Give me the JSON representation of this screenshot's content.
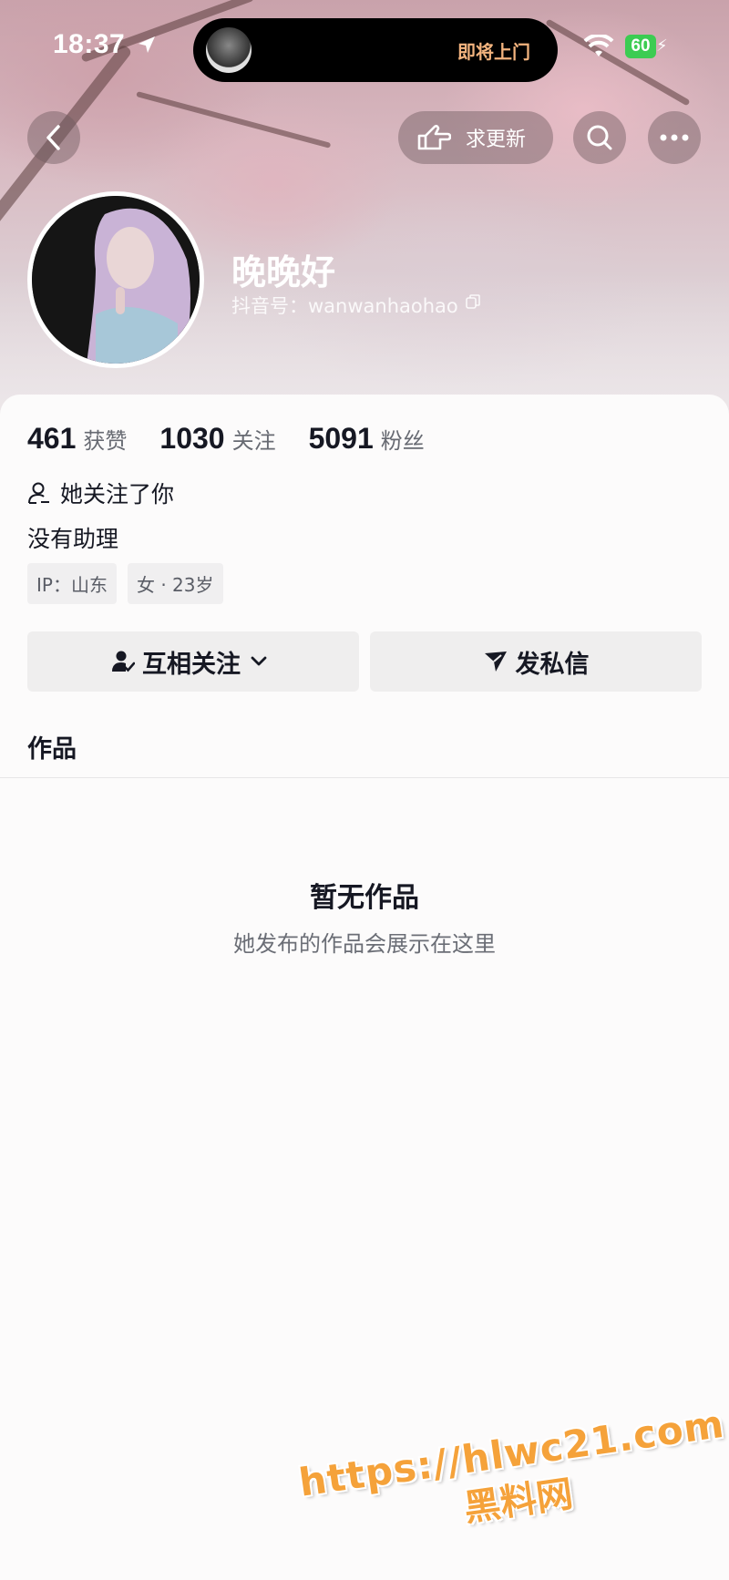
{
  "status_bar": {
    "time": "18:37",
    "island_text": "即将上门",
    "battery": "60"
  },
  "nav": {
    "update_label": "求更新"
  },
  "profile": {
    "nickname": "晚晚好",
    "douyin_id": "抖音号：wanwanhaohao"
  },
  "stats": [
    {
      "num": "461",
      "label": "获赞"
    },
    {
      "num": "1030",
      "label": "关注"
    },
    {
      "num": "5091",
      "label": "粉丝"
    }
  ],
  "follow_status": "她关注了你",
  "bio": "没有助理",
  "tags": [
    "IP：山东",
    "女 · 23岁"
  ],
  "actions": {
    "mutual_label": "互相关注",
    "message_label": "发私信"
  },
  "tabs": {
    "works_label": "作品"
  },
  "empty": {
    "title": "暂无作品",
    "subtitle": "她发布的作品会展示在这里"
  },
  "watermark": {
    "url": "https://hlwc21.com",
    "site": "黑料网"
  },
  "colors": {
    "battery": "#3ccc52",
    "island_text": "#f2b37e",
    "watermark": "#f5a23a"
  }
}
